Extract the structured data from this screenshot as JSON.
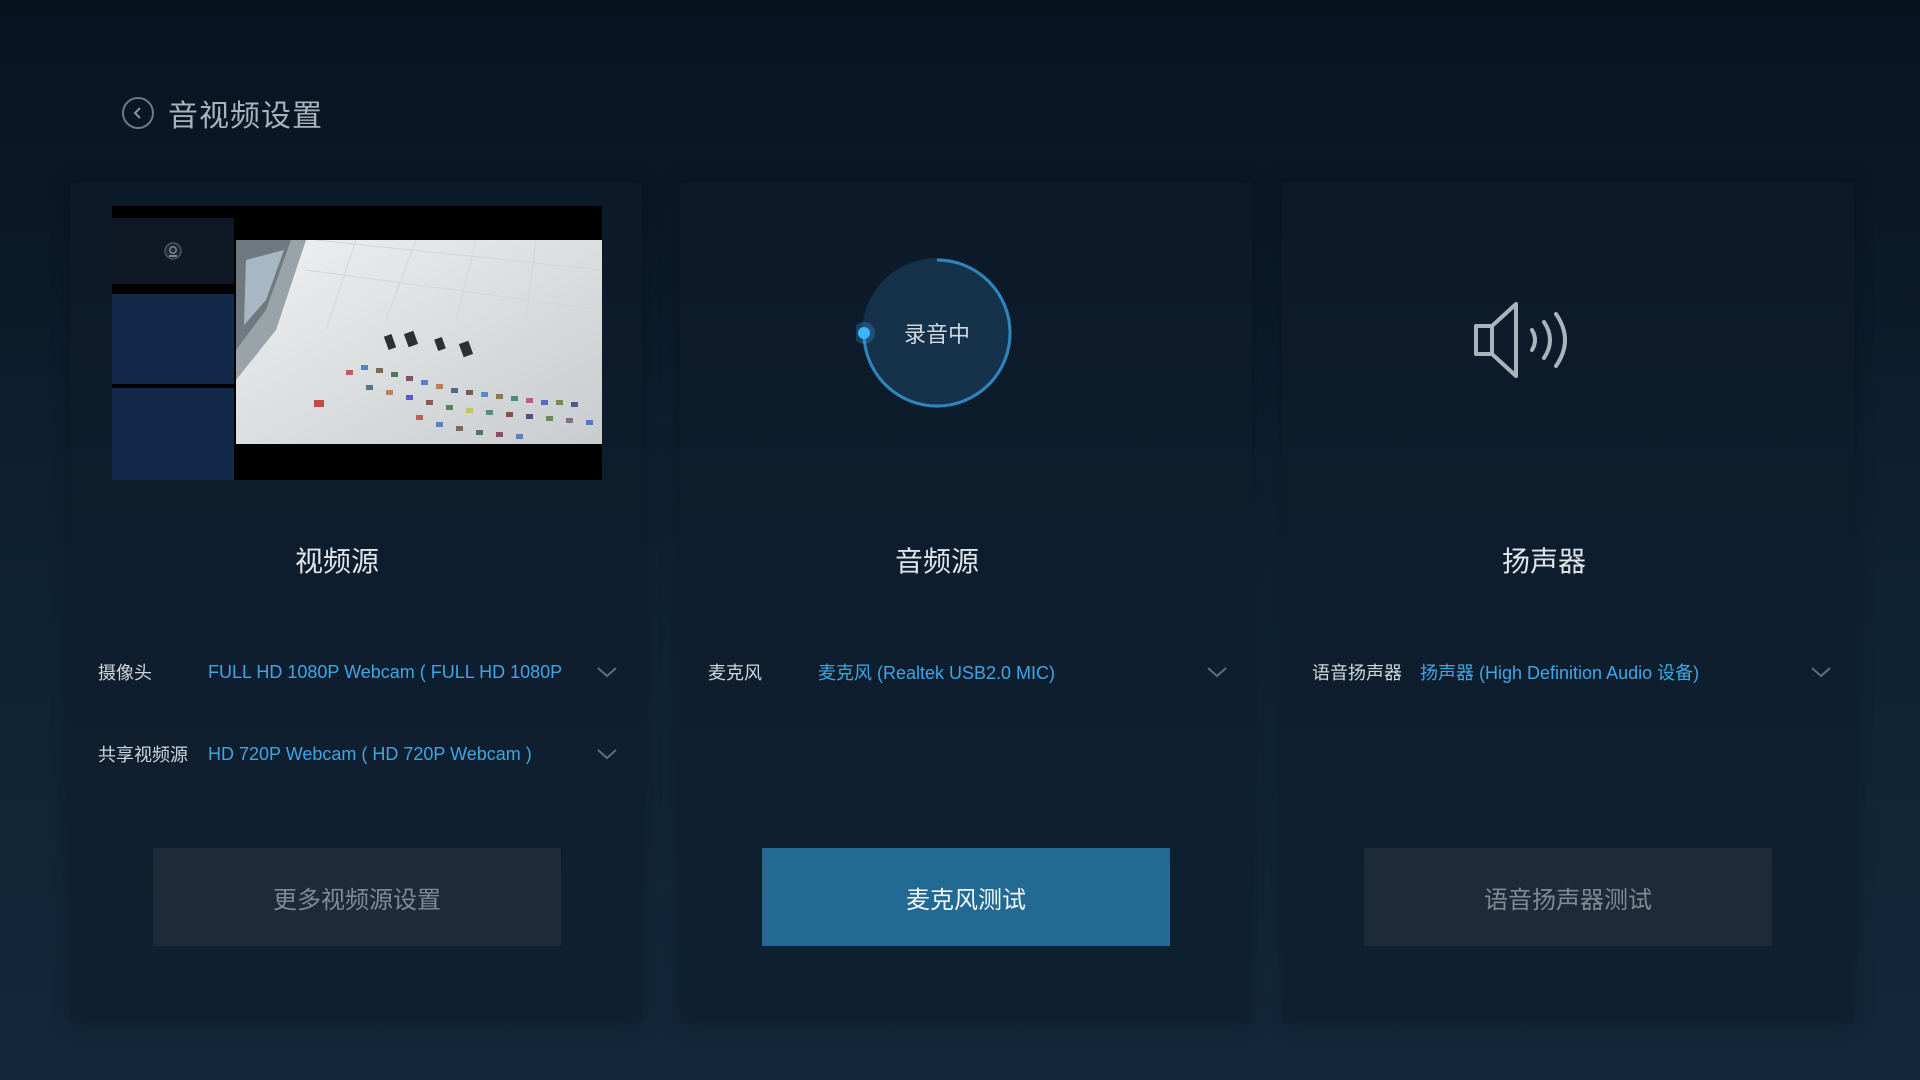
{
  "header": {
    "title": "音视频设置",
    "back_icon": "chevron-left-icon"
  },
  "video": {
    "title": "视频源",
    "camera_label": "摄像头",
    "camera_value": "FULL HD 1080P Webcam ( FULL HD 1080P",
    "share_label": "共享视频源",
    "share_value": "HD 720P Webcam ( HD 720P Webcam )",
    "button": "更多视频源设置"
  },
  "audio": {
    "title": "音频源",
    "status": "录音中",
    "mic_label": "麦克风",
    "mic_value": "麦克风 (Realtek USB2.0 MIC)",
    "button": "麦克风测试",
    "accent_color": "#3fa6e6"
  },
  "speaker": {
    "title": "扬声器",
    "label": "语音扬声器",
    "value": "扬声器 (High Definition Audio 设备)",
    "button": "语音扬声器测试",
    "icon": "speaker-icon"
  }
}
